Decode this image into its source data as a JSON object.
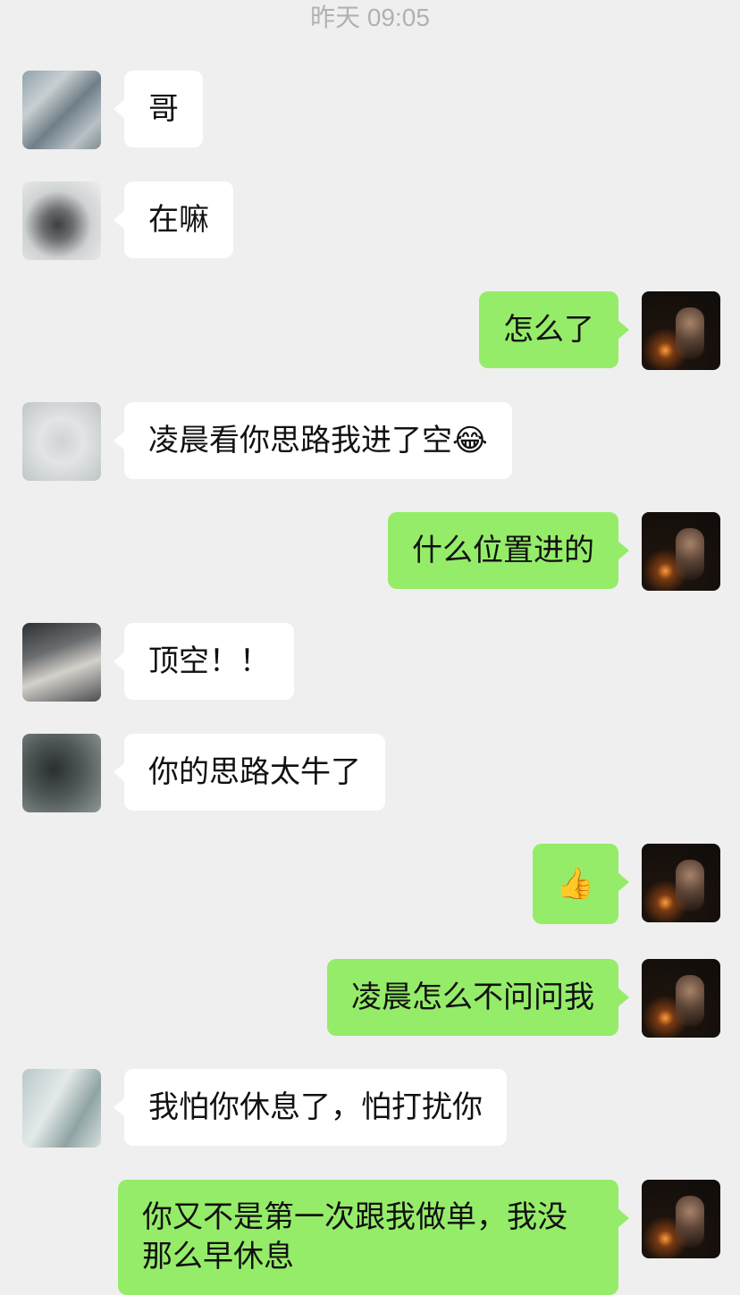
{
  "header": {
    "timestamp": "昨天 09:05"
  },
  "messages": [
    {
      "side": "in",
      "text": "哥"
    },
    {
      "side": "in",
      "text": "在嘛"
    },
    {
      "side": "out",
      "text": "怎么了"
    },
    {
      "side": "in",
      "text": "凌晨看你思路我进了空",
      "emoji": "😂"
    },
    {
      "side": "out",
      "text": "什么位置进的"
    },
    {
      "side": "in",
      "text": "顶空！！"
    },
    {
      "side": "in",
      "text": "你的思路太牛了"
    },
    {
      "side": "out",
      "text": "",
      "emoji": "👍"
    },
    {
      "side": "out",
      "text": "凌晨怎么不问问我"
    },
    {
      "side": "in",
      "text": "我怕你休息了，怕打扰你"
    },
    {
      "side": "out",
      "text": "你又不是第一次跟我做单，我没那么早休息"
    }
  ],
  "icons": {
    "contact_avatar": "contact-avatar",
    "self_avatar": "self-avatar"
  },
  "colors": {
    "background": "#efefef",
    "incoming_bubble": "#ffffff",
    "outgoing_bubble": "#95ec69",
    "timestamp": "#b1b1b1"
  }
}
